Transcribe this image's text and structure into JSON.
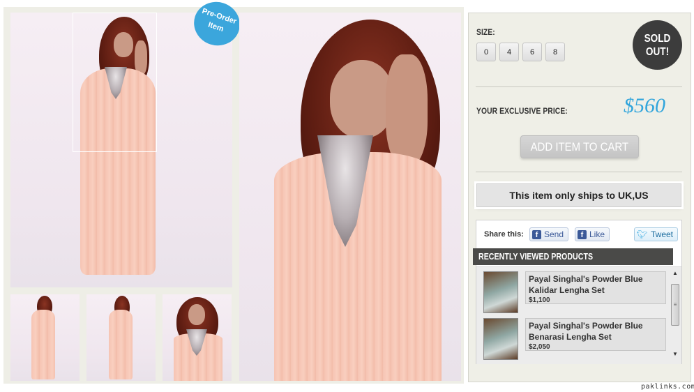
{
  "badge": {
    "line1": "Pre-Order",
    "line2": "Item"
  },
  "product": {
    "size_label": "SIZE:",
    "sizes": [
      "0",
      "4",
      "6",
      "8"
    ],
    "sold_out_line1": "SOLD",
    "sold_out_line2": "OUT!",
    "price_label": "YOUR EXCLUSIVE PRICE:",
    "price": "$560",
    "add_to_cart": "ADD ITEM TO CART",
    "shipping": "This item only ships to UK,US"
  },
  "share": {
    "label": "Share this:",
    "send": "Send",
    "like": "Like",
    "tweet": "Tweet",
    "fb_glyph": "f"
  },
  "recently_viewed": {
    "title": "RECENTLY VIEWED PRODUCTS",
    "items": [
      {
        "name": "Payal Singhal's Powder Blue Kalidar Lengha Set",
        "price": "$1,100"
      },
      {
        "name": "Payal Singhal's Powder Blue Benarasi Lengha Set",
        "price": "$2,050"
      }
    ]
  },
  "watermark": "paklinks.com",
  "colors": {
    "accent_price": "#31a5dc",
    "badge": "#3ba6dc",
    "sold_out": "#3c3c3c",
    "header_bar": "#4a4a48"
  },
  "icons": [
    "facebook-icon",
    "twitter-icon",
    "scroll-up-icon",
    "scroll-down-icon"
  ]
}
